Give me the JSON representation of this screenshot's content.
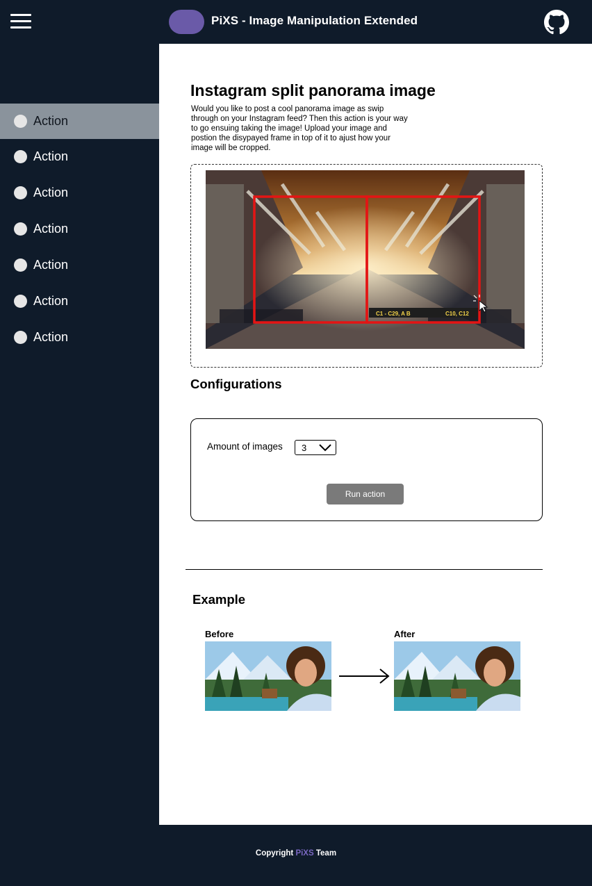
{
  "header": {
    "title": "PiXS - Image Manipulation Extended"
  },
  "sidebar": {
    "items": [
      {
        "label": "Action"
      },
      {
        "label": "Action"
      },
      {
        "label": "Action"
      },
      {
        "label": "Action"
      },
      {
        "label": "Action"
      },
      {
        "label": "Action"
      },
      {
        "label": "Action"
      }
    ]
  },
  "main": {
    "title": "Instagram split panorama image",
    "description": "Would you like to post a cool panorama image as swip through on your Instagram feed? Then this action is your way to go ensuing taking the image! Upload your image and postion the disypayed frame in top of it to ajust how your image will be cropped.",
    "panorama_signs": {
      "left": "C1 - C29, A B",
      "right": "C10, C12"
    },
    "configurations_title": "Configurations",
    "amount_label": "Amount of images",
    "amount_value": "3",
    "run_button": "Run action",
    "example_title": "Example",
    "before_label": "Before",
    "after_label": "After"
  },
  "footer": {
    "prefix": "Copyright",
    "brand": "PiXS",
    "suffix": "Team"
  },
  "colors": {
    "background": "#0f1b2a",
    "accent": "#6a5aa8",
    "active_item": "#8a939c",
    "frame": "#e41414"
  },
  "icons": [
    "hamburger-icon",
    "github-icon",
    "chevron-down-icon",
    "arrow-right-icon",
    "cursor-icon"
  ]
}
